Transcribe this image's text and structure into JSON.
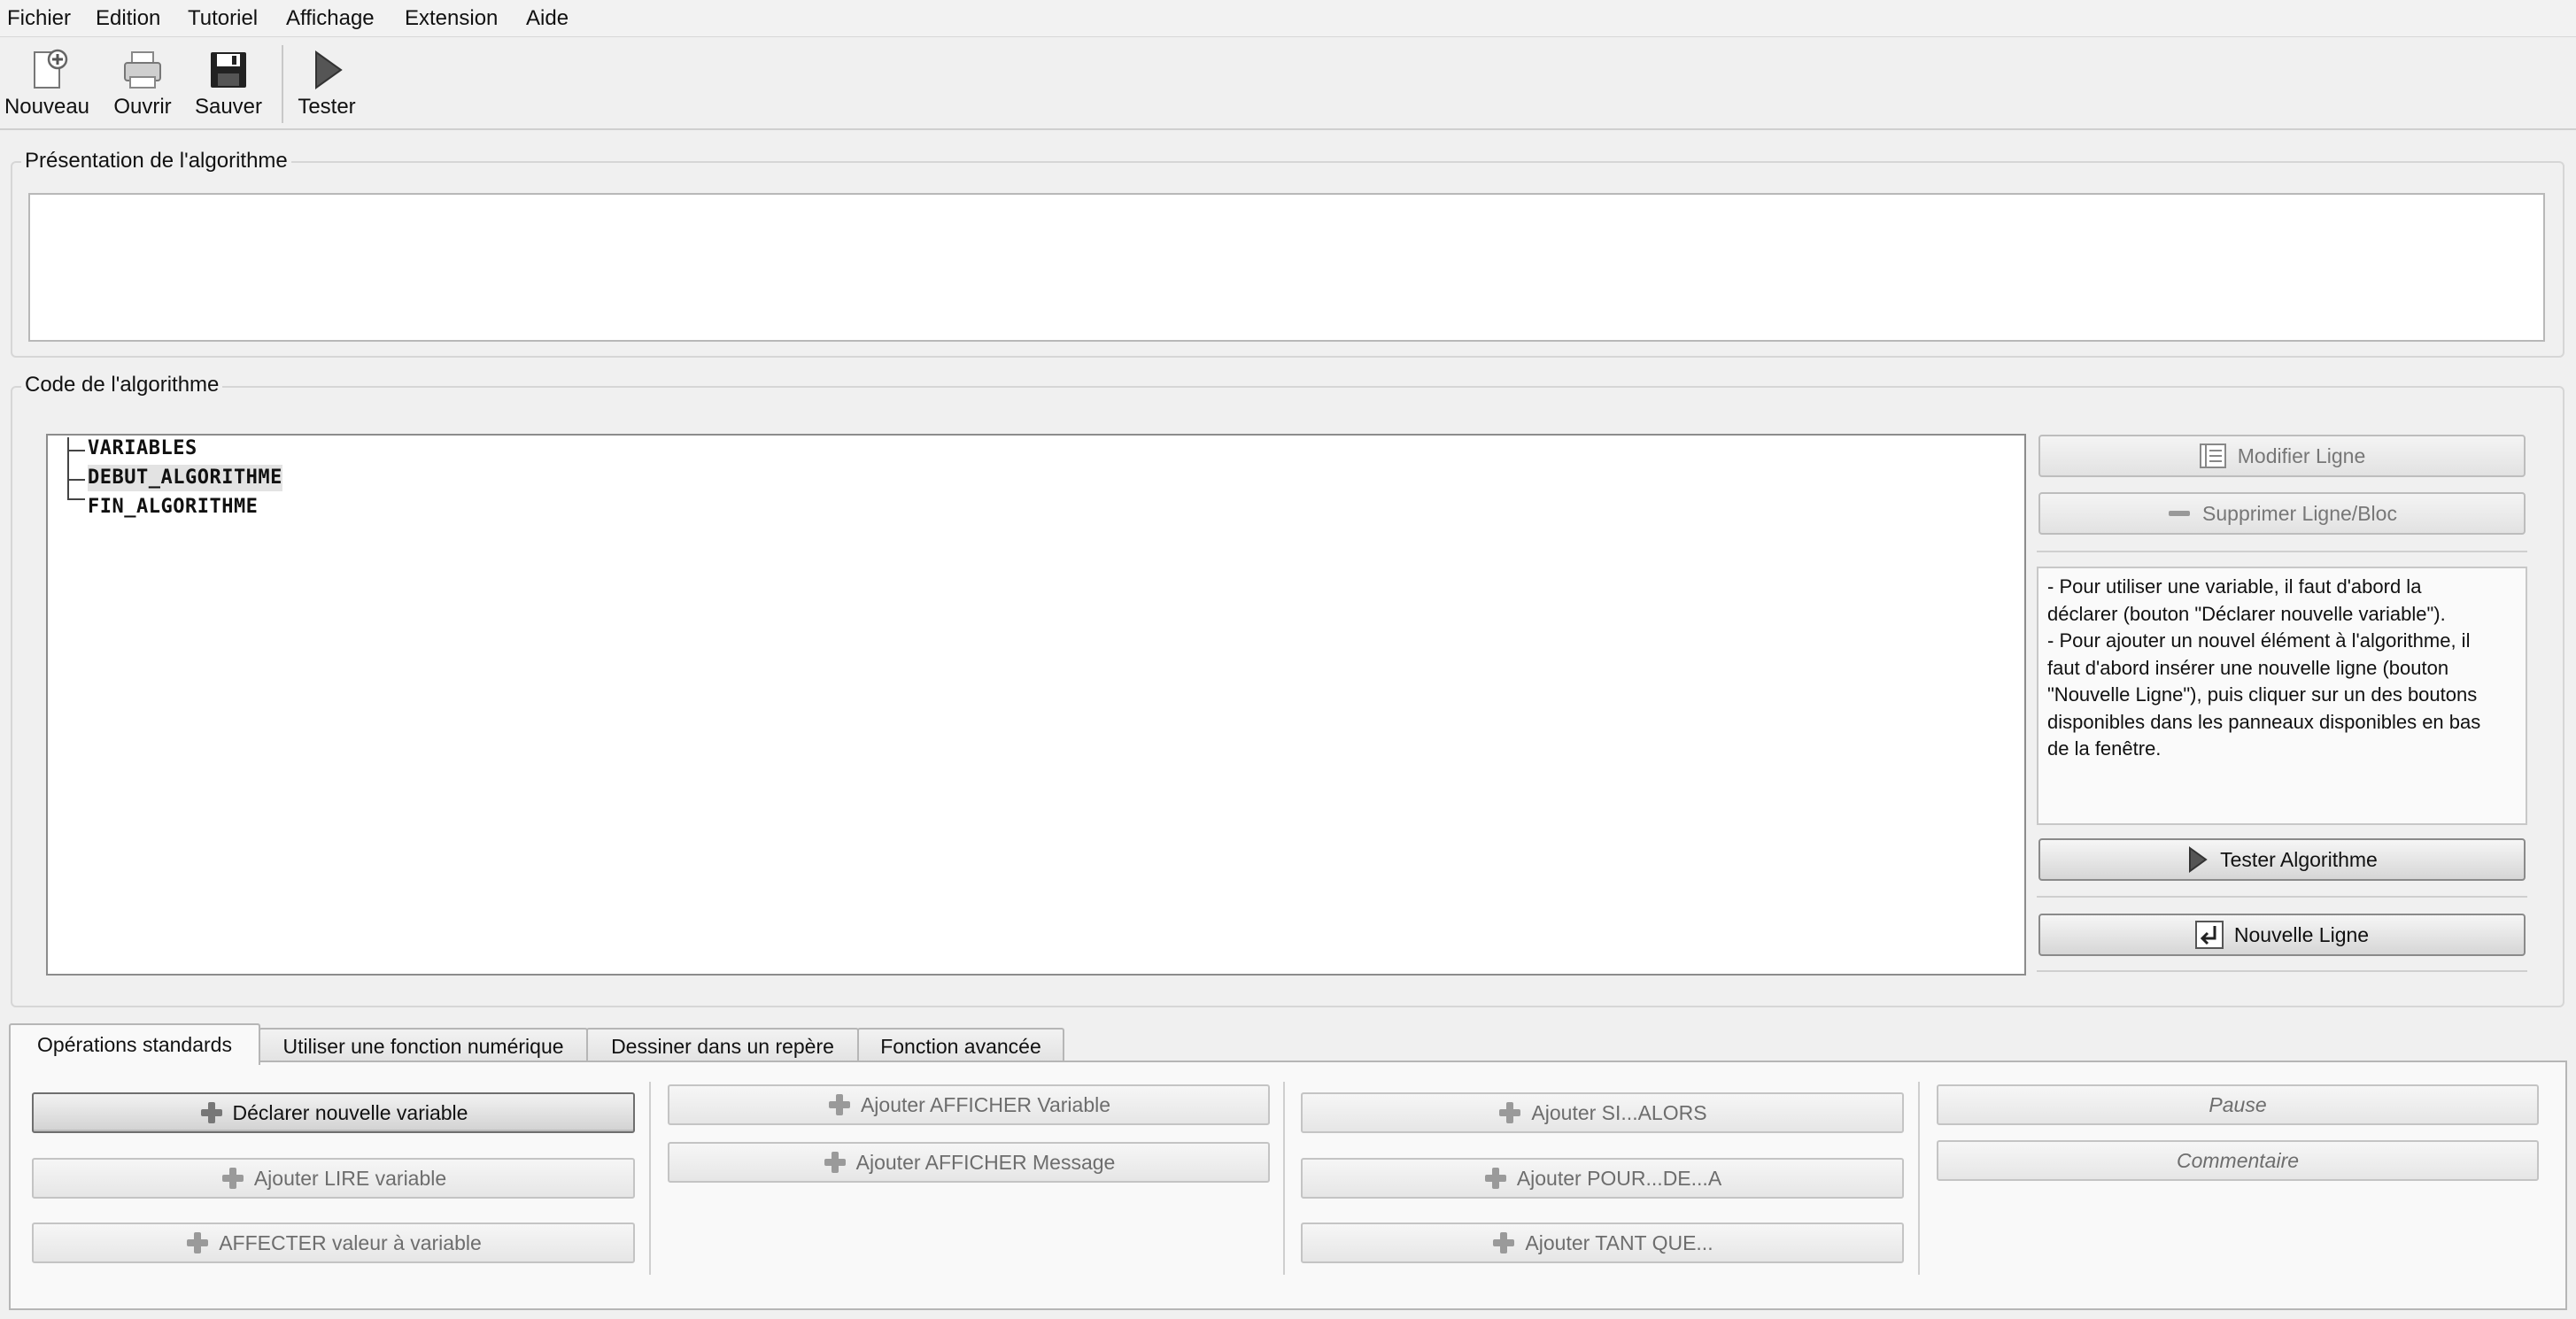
{
  "menu": [
    "Fichier",
    "Edition",
    "Tutoriel",
    "Affichage",
    "Extension",
    "Aide"
  ],
  "toolbar": {
    "new_label": "Nouveau",
    "open_label": "Ouvrir",
    "save_label": "Sauver",
    "test_label": "Tester"
  },
  "presentation": {
    "title": "Présentation de l'algorithme",
    "text": ""
  },
  "code": {
    "title": "Code de l'algorithme",
    "tree": [
      "VARIABLES",
      "DEBUT_ALGORITHME",
      "FIN_ALGORITHME"
    ],
    "selected_index": 1
  },
  "side": {
    "modify_label": "Modifier Ligne",
    "delete_label": "Supprimer Ligne/Bloc",
    "help_lines": [
      "- Pour utiliser une variable, il faut d'abord la",
      "déclarer (bouton \"Déclarer nouvelle variable\").",
      "- Pour ajouter un nouvel élément à l'algorithme, il",
      "faut d'abord insérer une nouvelle ligne (bouton",
      "\"Nouvelle Ligne\"), puis cliquer sur un des boutons",
      "disponibles dans les panneaux disponibles en bas",
      "de la fenêtre."
    ],
    "test_label": "Tester Algorithme",
    "newline_label": "Nouvelle Ligne"
  },
  "tabs": [
    "Opérations standards",
    "Utiliser une fonction numérique",
    "Dessiner dans un repère",
    "Fonction avancée"
  ],
  "ops": {
    "declare": "Déclarer nouvelle variable",
    "read": "Ajouter LIRE variable",
    "assign": "AFFECTER valeur à variable",
    "show_var": "Ajouter AFFICHER Variable",
    "show_msg": "Ajouter AFFICHER Message",
    "if": "Ajouter SI...ALORS",
    "for": "Ajouter POUR...DE...A",
    "while": "Ajouter TANT QUE...",
    "pause": "Pause",
    "comment": "Commentaire"
  }
}
